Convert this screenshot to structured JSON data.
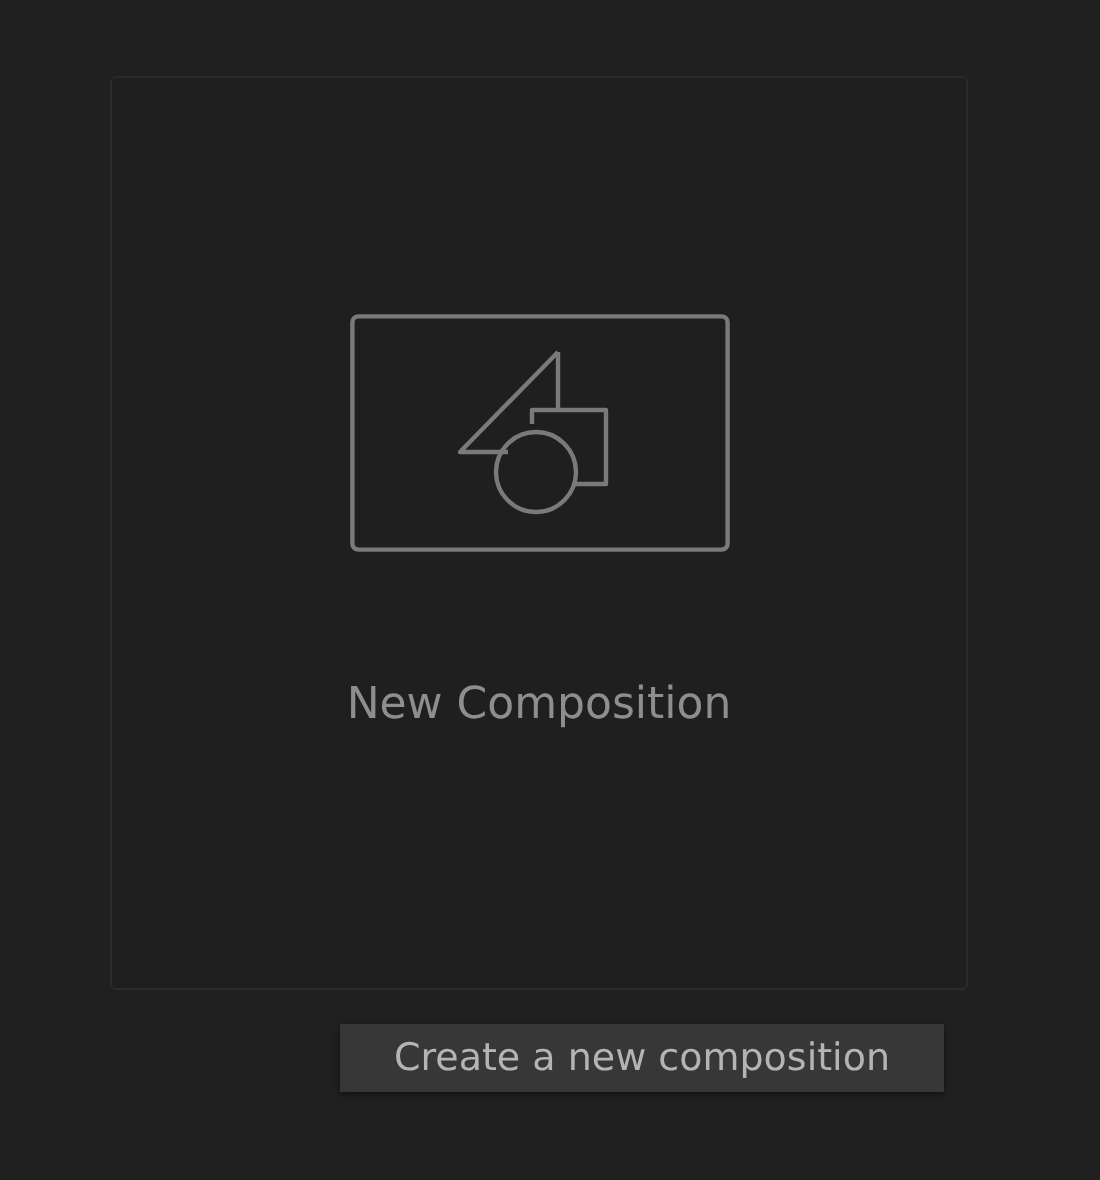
{
  "card": {
    "label": "New Composition"
  },
  "tooltip": {
    "text": "Create a new composition"
  }
}
